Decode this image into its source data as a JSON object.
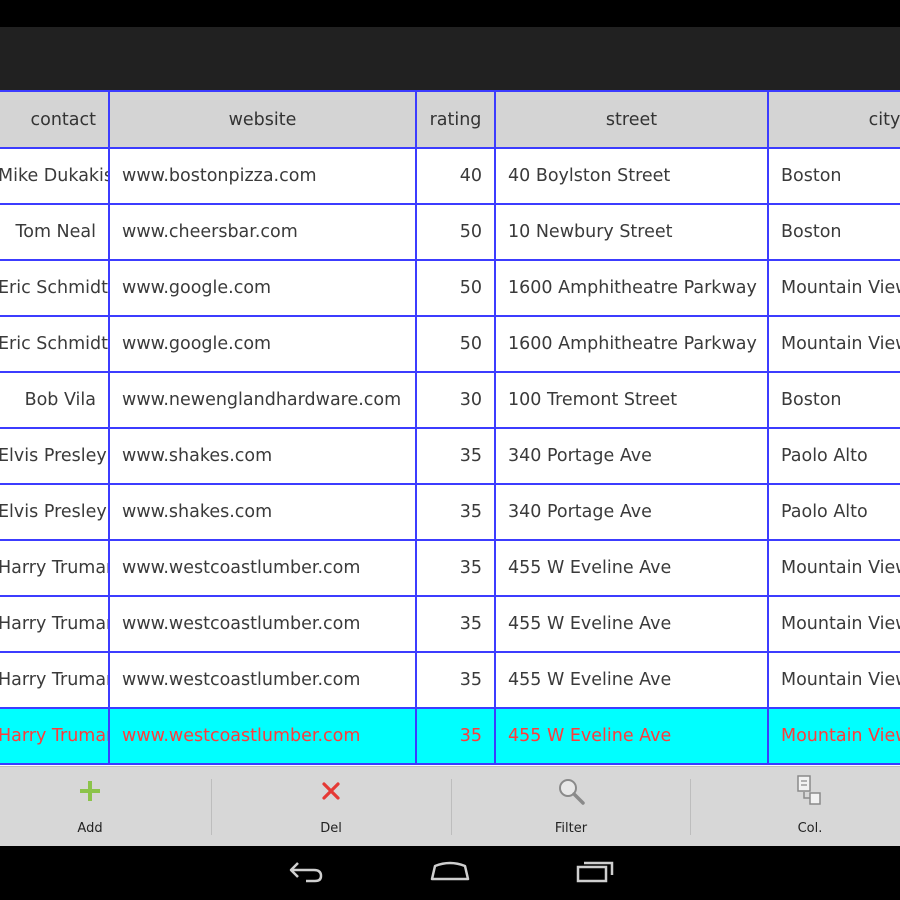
{
  "table": {
    "columns": [
      "contact",
      "website",
      "rating",
      "street",
      "city"
    ],
    "rows": [
      {
        "contact": "Mike Dukakis",
        "website": "www.bostonpizza.com",
        "rating": "40",
        "street": "40 Boylston Street",
        "city": "Boston"
      },
      {
        "contact": "Tom Neal",
        "website": "www.cheersbar.com",
        "rating": "50",
        "street": "10 Newbury Street",
        "city": "Boston"
      },
      {
        "contact": "Eric Schmidt",
        "website": "www.google.com",
        "rating": "50",
        "street": "1600 Amphitheatre Parkway",
        "city": "Mountain View"
      },
      {
        "contact": "Eric Schmidt",
        "website": "www.google.com",
        "rating": "50",
        "street": "1600 Amphitheatre Parkway",
        "city": "Mountain View"
      },
      {
        "contact": "Bob Vila",
        "website": "www.newenglandhardware.com",
        "rating": "30",
        "street": "100 Tremont Street",
        "city": "Boston"
      },
      {
        "contact": "Elvis Presley",
        "website": "www.shakes.com",
        "rating": "35",
        "street": "340 Portage Ave",
        "city": "Paolo Alto"
      },
      {
        "contact": "Elvis Presley",
        "website": "www.shakes.com",
        "rating": "35",
        "street": "340 Portage Ave",
        "city": "Paolo Alto"
      },
      {
        "contact": "Harry Truman",
        "website": "www.westcoastlumber.com",
        "rating": "35",
        "street": "455 W Eveline Ave",
        "city": "Mountain View"
      },
      {
        "contact": "Harry Truman",
        "website": "www.westcoastlumber.com",
        "rating": "35",
        "street": "455 W Eveline Ave",
        "city": "Mountain View"
      },
      {
        "contact": "Harry Truman",
        "website": "www.westcoastlumber.com",
        "rating": "35",
        "street": "455 W Eveline Ave",
        "city": "Mountain View"
      },
      {
        "contact": "Harry Truman",
        "website": "www.westcoastlumber.com",
        "rating": "35",
        "street": "455 W Eveline Ave",
        "city": "Mountain View"
      }
    ],
    "selected_row": 10
  },
  "toolbar": {
    "add_label": "Add",
    "del_label": "Del",
    "filter_label": "Filter",
    "col_label": "Col."
  },
  "icons": {
    "add": "plus-icon",
    "del": "close-icon",
    "filter": "magnifier-icon",
    "col": "columns-icon",
    "back": "back-icon",
    "home": "home-icon",
    "recents": "recents-icon"
  },
  "colors": {
    "grid_line": "#3c3cff",
    "header_bg": "#d4d4d4",
    "selected_bg": "#00ffff",
    "selected_text": "#ff3b3b",
    "add_icon": "#8bc34a",
    "del_icon": "#e53935"
  }
}
